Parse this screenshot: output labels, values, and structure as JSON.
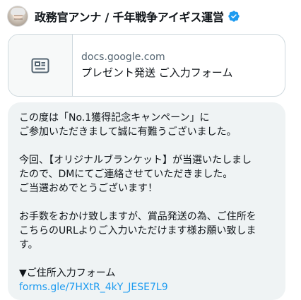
{
  "header": {
    "account_name": "政務官アンナ / 千年戦争アイギス運営",
    "verified_color": "#1d9bf0",
    "avatar": "avatar-image",
    "verified_icon": "verified-badge-icon"
  },
  "link_card": {
    "domain": "docs.google.com",
    "title": "プレゼント発送 ご入力フォーム",
    "thumbnail_icon": "article-icon"
  },
  "message": {
    "lines": [
      "この度は「No.1獲得記念キャンペーン」に",
      "ご参加いただきまして誠に有難うございました。",
      "",
      "今回、【オリジナルブランケット】が当選いたしまし",
      "たので、DMにてご連絡させていただきました。",
      "ご当選おめでとうございます！",
      "",
      "お手数をおかけ致しますが、賞品発送の為、ご住所を",
      "こちらのURLよりご入力いただけます様お願い致しま",
      "す。",
      "",
      "▼ご住所入力フォーム"
    ],
    "link_text": "forms.gle/7HXtR_4kY_JESE7L9"
  }
}
